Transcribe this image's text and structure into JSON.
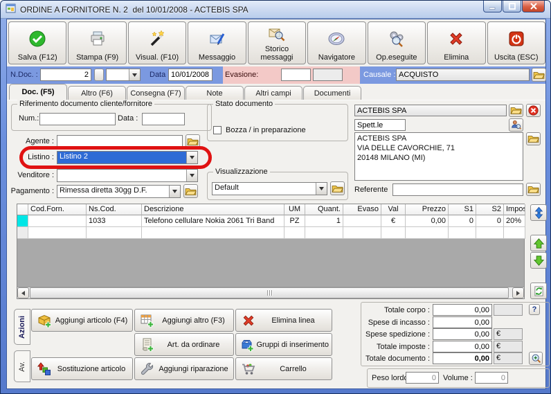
{
  "window": {
    "title": "ORDINE A FORNITORE N. 2  del 10/01/2008 - ACTEBIS SPA"
  },
  "toolbar": {
    "buttons": [
      {
        "label": "Salva (F12)",
        "icon": "check-circle-icon"
      },
      {
        "label": "Stampa (F9)",
        "icon": "printer-icon"
      },
      {
        "label": "Visual. (F10)",
        "icon": "magic-wand-icon"
      },
      {
        "label": "Messaggio",
        "icon": "mail-pen-icon"
      },
      {
        "label": "Storico messaggi",
        "icon": "mail-search-icon"
      },
      {
        "label": "Navigatore",
        "icon": "compass-icon"
      },
      {
        "label": "Op.eseguite",
        "icon": "gears-search-icon"
      },
      {
        "label": "Elimina",
        "icon": "delete-x-icon"
      },
      {
        "label": "Uscita (ESC)",
        "icon": "power-icon"
      }
    ]
  },
  "docbar": {
    "ndoc_label": "N.Doc. :",
    "ndoc_value": "2",
    "data_label": "Data :",
    "data_value": "10/01/2008",
    "evasione_label": "Evasione:",
    "evasione_value": "",
    "causale_label": "Causale :",
    "causale_value": "ACQUISTO"
  },
  "tabs": {
    "items": [
      {
        "label": "Doc. (F5)",
        "active": true
      },
      {
        "label": "Altro (F6)",
        "active": false
      },
      {
        "label": "Consegna (F7)",
        "active": false
      },
      {
        "label": "Note",
        "active": false
      },
      {
        "label": "Altri campi",
        "active": false
      },
      {
        "label": "Documenti",
        "active": false
      }
    ]
  },
  "form": {
    "riferimento_group": "Riferimento documento cliente/fornitore",
    "num_label": "Num.:",
    "num_value": "",
    "rif_data_label": "Data :",
    "rif_data_value": "",
    "agente_label": "Agente :",
    "agente_value": "",
    "listino_label": "Listino :",
    "listino_value": "Listino 2",
    "venditore_label": "Venditore :",
    "venditore_value": "",
    "pagamento_label": "Pagamento :",
    "pagamento_value": "Rimessa diretta 30gg D.F.",
    "stato_group": "Stato documento",
    "bozza_label": "Bozza / in preparazione",
    "bozza_checked": false,
    "visualizzazione_group": "Visualizzazione",
    "visualizzazione_value": "Default",
    "supplier_name": "ACTEBIS SPA",
    "salutation": "Spett.le",
    "address": "ACTEBIS SPA\nVIA DELLE CAVORCHIE, 71\n20148 MILANO (MI)",
    "referente_label": "Referente",
    "referente_value": ""
  },
  "grid": {
    "columns": [
      "Cod.Forn.",
      "Ns.Cod.",
      "Descrizione",
      "UM",
      "Quant.",
      "Evaso",
      "Val",
      "Prezzo",
      "S1",
      "S2",
      "Impos"
    ],
    "rows": [
      [
        "",
        "1033",
        "Telefono cellulare Nokia 2061 Tri Band",
        "PZ",
        "1",
        "",
        "€",
        "0,00",
        "0",
        "0",
        "20%"
      ]
    ]
  },
  "actions": {
    "tab_primary": "Azioni",
    "tab_secondary": "Av.",
    "buttons": [
      {
        "label": "Aggiungi articolo (F4)",
        "icon": "cube-plus-icon"
      },
      {
        "label": "Aggiungi altro (F3)",
        "icon": "table-plus-icon"
      },
      {
        "label": "Elimina linea",
        "icon": "delete-x-icon"
      },
      {
        "label": "Art. da ordinare",
        "icon": "list-plus-icon"
      },
      {
        "label": "Gruppi di inserimento",
        "icon": "box-plus-icon"
      },
      {
        "label": "Sostituzione articolo",
        "icon": "swap-icon"
      },
      {
        "label": "Aggiungi riparazione",
        "icon": "wrench-icon"
      },
      {
        "label": "Carrello",
        "icon": "cart-icon"
      }
    ]
  },
  "totals": {
    "rows": [
      {
        "label": "Totale corpo :",
        "value": "0,00",
        "suffix": ""
      },
      {
        "label": "Spese di incasso :",
        "value": "0,00",
        "suffix": ""
      },
      {
        "label": "Spese spedizione :",
        "value": "0,00",
        "suffix": "€"
      },
      {
        "label": "Totale imposte :",
        "value": "0,00",
        "suffix": "€"
      },
      {
        "label": "Totale documento :",
        "value": "0,00",
        "suffix": "€"
      }
    ],
    "help_label": "?",
    "peso_label": "Peso lordo :",
    "peso_value": "0",
    "volume_label": "Volume :",
    "volume_value": "0"
  },
  "colors": {
    "docbar_blue": "#7b99e0",
    "evasione_pink": "#f3c9c7",
    "selection_blue": "#2e6bd5",
    "annotation_red": "#e01212",
    "row_selector_cyan": "#00e6e6"
  }
}
